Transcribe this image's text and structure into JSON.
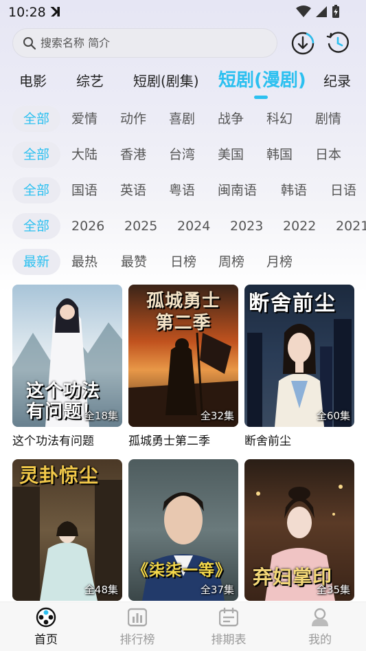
{
  "status": {
    "time": "10:28",
    "ghost": "ꓘ"
  },
  "search": {
    "placeholder": "搜索名称 简介"
  },
  "channels": [
    "电影",
    "综艺",
    "短剧(剧集)",
    "短剧(漫剧)",
    "纪录"
  ],
  "filters": {
    "genre": [
      "全部",
      "爱情",
      "动作",
      "喜剧",
      "战争",
      "科幻",
      "剧情"
    ],
    "region": [
      "全部",
      "大陆",
      "香港",
      "台湾",
      "美国",
      "韩国",
      "日本"
    ],
    "language": [
      "全部",
      "国语",
      "英语",
      "粤语",
      "闽南语",
      "韩语",
      "日语"
    ],
    "year": [
      "全部",
      "2026",
      "2025",
      "2024",
      "2023",
      "2022",
      "2021"
    ],
    "sort": [
      "最新",
      "最热",
      "最赞",
      "日榜",
      "周榜",
      "月榜"
    ]
  },
  "cards": [
    {
      "title": "这个功法有问题",
      "episodes": "全18集",
      "art": "这个功法\n有问题！"
    },
    {
      "title": "孤城勇士第二季",
      "episodes": "全32集",
      "art": "孤城勇士\n第二季"
    },
    {
      "title": "断舍前尘",
      "episodes": "全60集",
      "art": "断舍前尘"
    },
    {
      "title": "",
      "episodes": "全48集",
      "art": "灵卦惊尘"
    },
    {
      "title": "",
      "episodes": "全37集",
      "art": "《柒柒一等》"
    },
    {
      "title": "",
      "episodes": "全35集",
      "art": "弃妇掌印"
    }
  ],
  "nav": [
    {
      "label": "首页",
      "icon": "film-reel-icon"
    },
    {
      "label": "排行榜",
      "icon": "bar-chart-icon"
    },
    {
      "label": "排期表",
      "icon": "calendar-icon"
    },
    {
      "label": "我的",
      "icon": "user-icon"
    }
  ],
  "colors": {
    "accent": "#2cc0f0",
    "inactive_nav": "#999999"
  }
}
